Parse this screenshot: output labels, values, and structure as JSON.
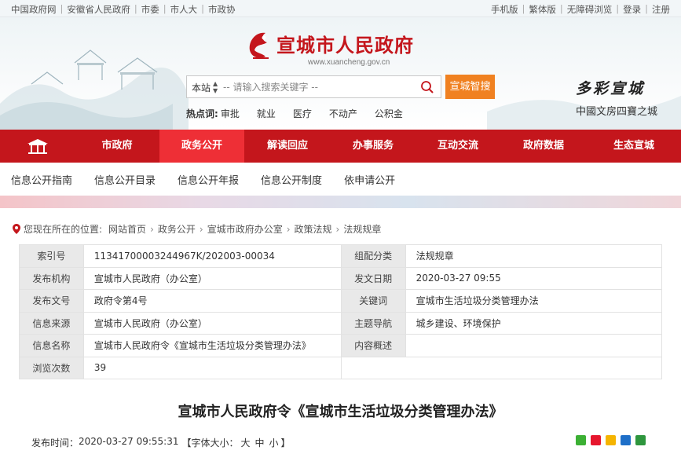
{
  "topbar": {
    "left_links": [
      "中国政府网",
      "安徽省人民政府",
      "市委",
      "市人大",
      "市政协"
    ],
    "right_links": [
      "手机版",
      "繁体版",
      "无障碍浏览",
      "登录",
      "注册"
    ]
  },
  "header": {
    "site_title": "宣城市人民政府",
    "site_domain": "www.xuancheng.gov.cn",
    "search": {
      "scope": "本站",
      "placeholder": "-- 请输入搜索关键字 --",
      "smart_button": "宣城智搜"
    },
    "hot": {
      "label": "热点词:",
      "items": [
        "审批",
        "就业",
        "医疗",
        "不动产",
        "公积金"
      ]
    },
    "slogan_main": "多彩宣城",
    "slogan_sub": "中國文房四寶之城"
  },
  "main_nav": {
    "items": [
      "市政府",
      "政务公开",
      "解读回应",
      "办事服务",
      "互动交流",
      "政府数据",
      "生态宣城"
    ],
    "active": "政务公开"
  },
  "sub_nav": {
    "items": [
      "信息公开指南",
      "信息公开目录",
      "信息公开年报",
      "信息公开制度",
      "依申请公开"
    ]
  },
  "breadcrumb": {
    "label": "您现在所在的位置:",
    "items": [
      "网站首页",
      "政务公开",
      "宣城市政府办公室",
      "政策法规",
      "法规规章"
    ]
  },
  "info": {
    "rows": [
      {
        "k1": "索引号",
        "v1": "11341700003244967K/202003-00034",
        "k2": "组配分类",
        "v2": "法规规章"
      },
      {
        "k1": "发布机构",
        "v1": "宣城市人民政府（办公室）",
        "k2": "发文日期",
        "v2": "2020-03-27 09:55"
      },
      {
        "k1": "发布文号",
        "v1": "政府令第4号",
        "k2": "关键词",
        "v2": "宣城市生活垃圾分类管理办法"
      },
      {
        "k1": "信息来源",
        "v1": "宣城市人民政府（办公室）",
        "k2": "主题导航",
        "v2": "城乡建设、环境保护"
      },
      {
        "k1": "信息名称",
        "v1": "宣城市人民政府令《宣城市生活垃圾分类管理办法》",
        "k2": "内容概述",
        "v2": ""
      },
      {
        "k1": "浏览次数",
        "v1": "39"
      }
    ]
  },
  "document": {
    "title": "宣城市人民政府令《宣城市生活垃圾分类管理办法》",
    "publish_label": "发布时间：",
    "publish_time": "2020-03-27 09:55:31",
    "font_size_label": "【字体大小：",
    "font_sizes": [
      "大",
      "中",
      "小"
    ],
    "font_size_end": "】"
  },
  "colors": {
    "brand_red": "#c4161c",
    "nav_active": "#ee2f36",
    "search_orange": "#f08121"
  },
  "share_icons": [
    "wechat-icon",
    "weibo-icon",
    "qzone-icon",
    "renren-icon",
    "douban-icon"
  ]
}
